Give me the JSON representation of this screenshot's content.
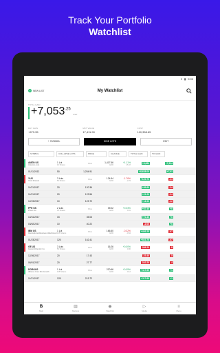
{
  "headline": {
    "line1": "Track Your Portfolio",
    "line2": "Watchlist"
  },
  "statusbar": {
    "time": "9:00"
  },
  "topbar": {
    "new_list": "NEW LIST",
    "title": "My Watchlist"
  },
  "total": {
    "label": "TOTAL GAIN",
    "whole": "+7,053",
    "cents": ".25",
    "currency": "USD",
    "cols": [
      {
        "k": "DAY GAIN",
        "v": "+673.35"
      },
      {
        "k": "MKT VALUE",
        "v": "17,411.90"
      },
      {
        "k": "COST",
        "v": "110,358.65"
      }
    ]
  },
  "buttons": {
    "symbol": "+ SYMBOL",
    "hide_lots": "HIDE LOTS",
    "edit": "EDIT"
  },
  "columns": [
    "SYMBOL",
    "COLLAPSE LOTS",
    "PRICE",
    "CHANGE",
    "TOTAL GAIN",
    "TO GAIN"
  ],
  "rows": [
    {
      "type": "sym",
      "c1": "AMZN US",
      "s1": "Amazon.com",
      "c2": "1 Lot",
      "s2": "10 Shares",
      "c3": "",
      "s3": "Price",
      "c4": "1,417.66",
      "s4": "EOD",
      "c5": "+1.11%",
      "s5": "15.47",
      "c6": "+8,684",
      "c7": "+7,914",
      "accent": "#2ec07a",
      "p6": "#2ec07a",
      "p7": "#2ec07a"
    },
    {
      "type": "lot",
      "c1": "01/11/2012",
      "c2": "50",
      "c3": "1,254.91",
      "c4": "",
      "c5": "",
      "c6": "+8,638.00",
      "c7": "+7,91",
      "p6": "#2ec07a",
      "p7": "#2ec07a"
    },
    {
      "type": "sym",
      "c1": "YUS",
      "s1": "Yum! Brands",
      "c2": "3 Lots",
      "s2": "50 Shares",
      "c3": "",
      "s3": "Price",
      "c4": "124.64",
      "s4": "EOD",
      "c5": "-1.76%",
      "s5": "-2.23",
      "c6": "+120.70",
      "c7": "-24",
      "accent": "#e0303a",
      "p6": "#2ec07a",
      "p7": "#e0303a"
    },
    {
      "type": "lot",
      "c1": "11/21/2017",
      "c2": "20",
      "c3": "120.36",
      "c4": "",
      "c5": "",
      "c6": "+89.60",
      "c7": "-24",
      "p6": "#2ec07a",
      "p7": "#e0303a"
    },
    {
      "type": "lot",
      "c1": "11/21/2017",
      "c2": "20",
      "c3": "123.56",
      "c4": "",
      "c5": "",
      "c6": "+21.20",
      "c7": "-24",
      "p6": "#2ec07a",
      "p7": "#e0303a"
    },
    {
      "type": "lot",
      "c1": "12/19/2017",
      "c2": "10",
      "c3": "123.72",
      "c4": "",
      "c5": "",
      "c6": "+16.90",
      "c7": "-12",
      "p6": "#2ec07a",
      "p7": "#e0303a"
    },
    {
      "type": "sym",
      "c1": "PFE US",
      "s1": "Pfizer Inc.",
      "c2": "2 Lots",
      "s2": "30 Shares",
      "c3": "",
      "s3": "Price",
      "c4": "39.02",
      "s4": "EOD",
      "c5": "+0.03%",
      "s5": "0.01",
      "c6": "+87.40",
      "c7": "+0",
      "accent": "#2ec07a",
      "p6": "#2ec07a",
      "p7": "#2ec07a"
    },
    {
      "type": "lot",
      "c1": "10/31/2017",
      "c2": "15",
      "c3": "35.06",
      "c4": "",
      "c5": "",
      "c6": "+70.40",
      "c7": "+0",
      "p6": "#2ec07a",
      "p7": "#2ec07a"
    },
    {
      "type": "lot",
      "c1": "03/02/2017",
      "c2": "10",
      "c3": "40.22",
      "c4": "",
      "c5": "",
      "c6": "-2.00",
      "c7": "+0",
      "p6": "#e0303a",
      "p7": "#2ec07a"
    },
    {
      "type": "sym",
      "c1": "IBM US",
      "s1": "International Business Machines Corp",
      "c2": "1 Lot",
      "s2": "125 Shares",
      "c3": "",
      "s3": "Price",
      "c4": "166.60",
      "s4": "EOD",
      "c5": "-0.32%",
      "s5": "-0.54",
      "c6": "+493.25",
      "c7": "-67",
      "accent": "#e0303a",
      "p6": "#2ec07a",
      "p7": "#e0303a"
    },
    {
      "type": "lot",
      "c1": "01/23/2017",
      "c2": "125",
      "c3": "162.41",
      "c4": "",
      "c5": "",
      "c6": "+523.75",
      "c7": "-67",
      "p6": "#2ec07a",
      "p7": "#e0303a"
    },
    {
      "type": "sym",
      "c1": "GE US",
      "s1": "General Electric Co",
      "c2": "3 Lots",
      "s2": "50 Shares",
      "c3": "",
      "s3": "Price",
      "c4": "16.26",
      "s4": "EOD",
      "c5": "+0.00%",
      "s5": "0.00",
      "c6": "-366.20",
      "c7": "-8",
      "accent": "#e0303a",
      "p6": "#e0303a",
      "p7": "#e0303a"
    },
    {
      "type": "lot",
      "c1": "12/26/2017",
      "c2": "20",
      "c3": "17.43",
      "c4": "",
      "c5": "",
      "c6": "-23.40",
      "c7": "-5",
      "p6": "#e0303a",
      "p7": "#e0303a"
    },
    {
      "type": "lot",
      "c1": "06/01/2017",
      "c2": "20",
      "c3": "27.77",
      "c4": "",
      "c5": "",
      "c6": "-342.20",
      "c7": "-4",
      "p6": "#e0303a",
      "p7": "#e0303a"
    },
    {
      "type": "sym",
      "c1": "DGROUS",
      "s1": "iShares Core Div Growth",
      "c2": "1 Lot",
      "s2": "125 Shares",
      "c3": "",
      "s3": "Price",
      "c4": "220.66",
      "s4": "EOD",
      "c5": "+0.05%",
      "s5": "0.12",
      "c6": "+117.60",
      "c7": "+1",
      "accent": "#2ec07a",
      "p6": "#2ec07a",
      "p7": "#2ec07a"
    },
    {
      "type": "lot",
      "c1": "11/21/2017",
      "c2": "125",
      "c3": "219.72",
      "c4": "",
      "c5": "",
      "c6": "+117.60",
      "c7": "+1",
      "p6": "#2ec07a",
      "p7": "#2ec07a"
    }
  ],
  "tabs": [
    {
      "icon": "B",
      "label": "Main"
    },
    {
      "icon": "▥",
      "label": "Markets"
    },
    {
      "icon": "◉",
      "label": "Watchlist"
    },
    {
      "icon": "▷",
      "label": "Media"
    },
    {
      "icon": "≡",
      "label": "Menu"
    }
  ]
}
